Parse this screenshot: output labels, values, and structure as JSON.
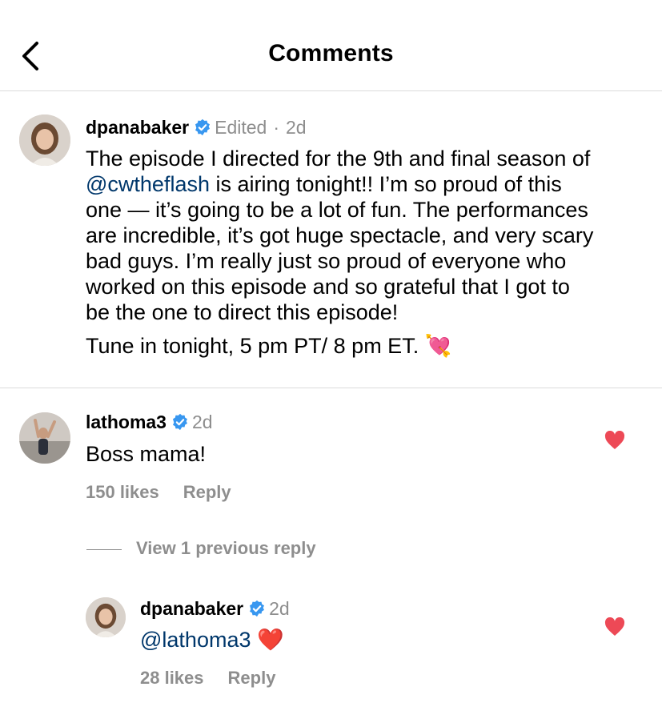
{
  "header": {
    "title": "Comments"
  },
  "caption": {
    "username": "dpanabaker",
    "edited": "Edited",
    "separator": "·",
    "time": "2d",
    "line1": "The episode I directed for the 9th and final season of",
    "mention": "@cwtheflash",
    "line2_rest": " is airing tonight!! I’m so proud of this",
    "line3": "one — it’s going to be a lot of fun. The performances",
    "line4": "are incredible, it’s got huge spectacle, and very scary",
    "line5": "bad guys. I’m really just so proud of everyone who",
    "line6": "worked on this episode and so grateful that I got to",
    "line7": "be the one to direct this episode!",
    "line8": "Tune in tonight, 5 pm PT/ 8 pm ET.",
    "emoji": "💘"
  },
  "comment": {
    "username": "lathoma3",
    "time": "2d",
    "text": "Boss mama!",
    "likes": "150 likes",
    "reply": "Reply"
  },
  "view_replies": "View 1 previous reply",
  "reply": {
    "username": "dpanabaker",
    "time": "2d",
    "mention": "@lathoma3",
    "emoji": "❤️",
    "likes": "28 likes",
    "reply": "Reply"
  },
  "colors": {
    "verified": "#3897f0",
    "heart": "#ed4956",
    "mention": "#00376b",
    "muted": "#8e8e8e",
    "divider": "#dbdbdb"
  }
}
